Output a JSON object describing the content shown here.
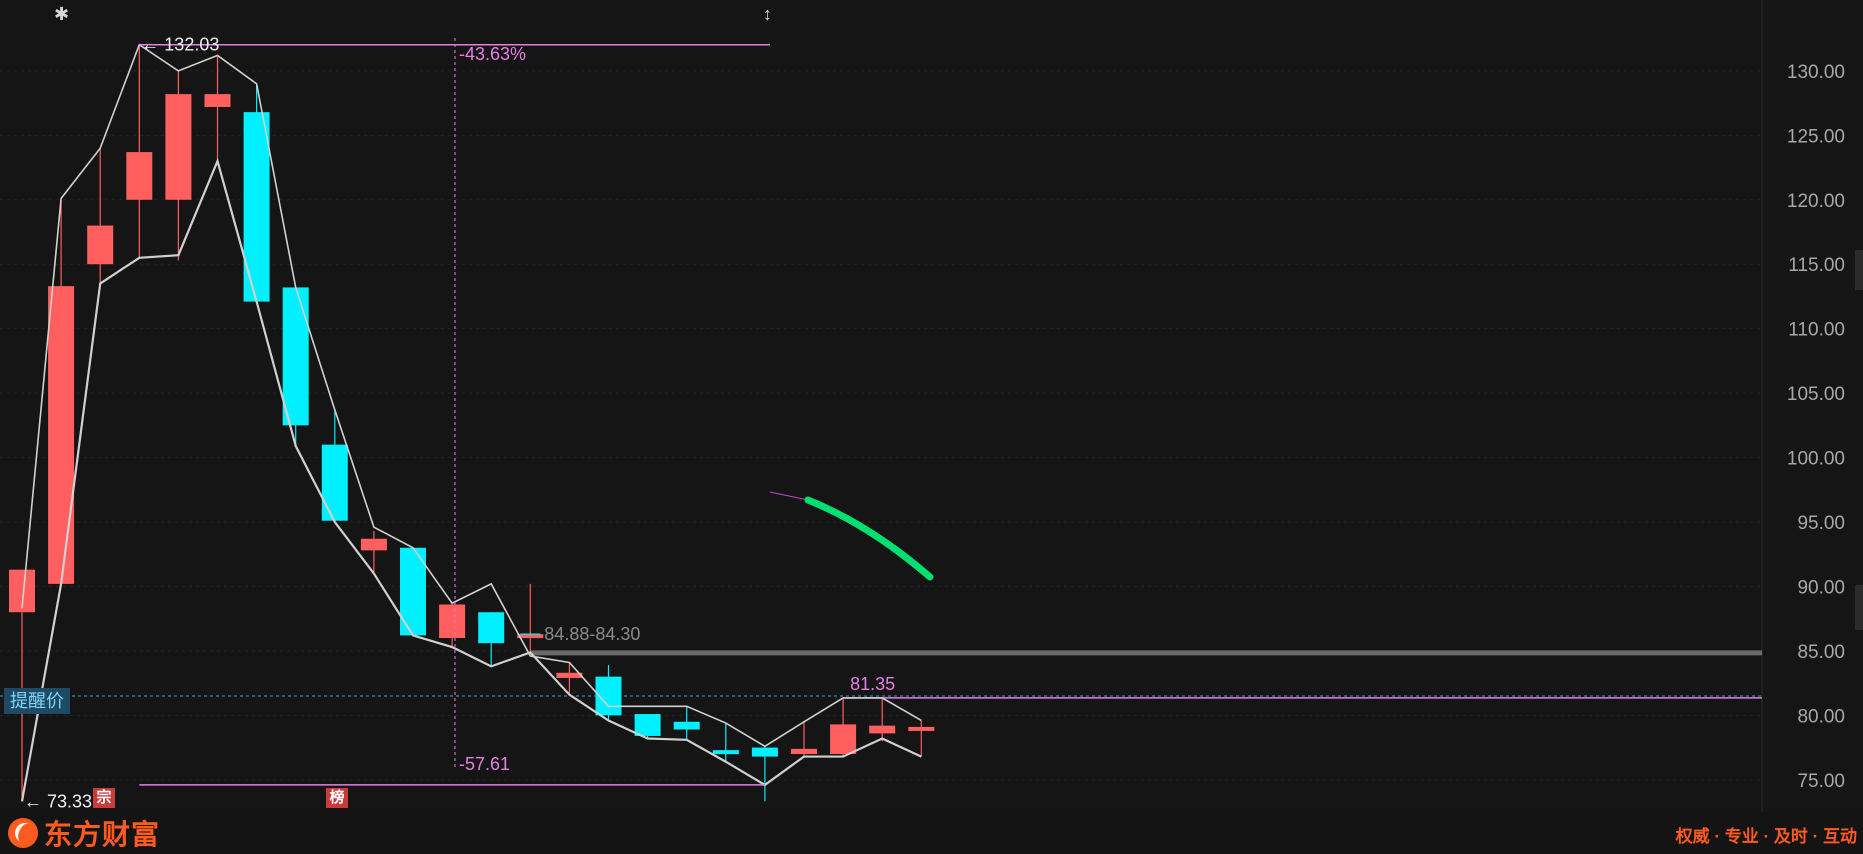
{
  "chart_data": {
    "type": "candlestick",
    "ylim": [
      72.5,
      135.5
    ],
    "y_ticks": [
      "75.00",
      "80.00",
      "85.00",
      "90.00",
      "95.00",
      "100.00",
      "105.00",
      "110.00",
      "115.00",
      "120.00",
      "125.00",
      "130.00"
    ],
    "candles": [
      {
        "open": 88.0,
        "close": 91.3,
        "high": 91.3,
        "low": 73.33
      },
      {
        "open": 90.2,
        "close": 113.3,
        "high": 120.0,
        "low": 90.2
      },
      {
        "open": 115.0,
        "close": 118.0,
        "high": 124.0,
        "low": 113.5
      },
      {
        "open": 120.0,
        "close": 123.7,
        "high": 132.03,
        "low": 115.5
      },
      {
        "open": 120.0,
        "close": 128.2,
        "high": 130.0,
        "low": 115.3
      },
      {
        "open": 127.2,
        "close": 128.2,
        "high": 131.2,
        "low": 123.0
      },
      {
        "open": 126.8,
        "close": 112.1,
        "high": 129.0,
        "low": 112.1
      },
      {
        "open": 113.2,
        "close": 102.5,
        "high": 113.2,
        "low": 100.9
      },
      {
        "open": 101.0,
        "close": 95.1,
        "high": 103.7,
        "low": 95.0
      },
      {
        "open": 92.8,
        "close": 93.7,
        "high": 94.3,
        "low": 91.0
      },
      {
        "open": 93.0,
        "close": 86.2,
        "high": 93.0,
        "low": 86.2
      },
      {
        "open": 86.0,
        "close": 88.6,
        "high": 88.7,
        "low": 85.2
      },
      {
        "open": 88.0,
        "close": 85.6,
        "high": 88.0,
        "low": 83.8
      },
      {
        "open": 86.3,
        "close": 86.3,
        "high": 90.2,
        "low": 84.88
      },
      {
        "open": 82.9,
        "close": 83.3,
        "high": 84.1,
        "low": 81.6
      },
      {
        "open": 83.0,
        "close": 80.0,
        "high": 83.9,
        "low": 79.6
      },
      {
        "open": 80.1,
        "close": 78.4,
        "high": 80.1,
        "low": 78.2
      },
      {
        "open": 79.5,
        "close": 78.9,
        "high": 80.7,
        "low": 78.1
      },
      {
        "open": 77.3,
        "close": 77.0,
        "high": 79.4,
        "low": 76.4
      },
      {
        "open": 77.5,
        "close": 76.8,
        "high": 77.6,
        "low": 73.33
      },
      {
        "open": 77.0,
        "close": 77.4,
        "high": 79.5,
        "low": 76.8
      },
      {
        "open": 77.0,
        "close": 79.3,
        "high": 81.35,
        "low": 76.8
      },
      {
        "open": 78.6,
        "close": 79.2,
        "high": 81.35,
        "low": 78.0
      },
      {
        "open": 78.9,
        "close": 79.1,
        "high": 79.6,
        "low": 76.8
      }
    ],
    "upper_line": [
      88.3,
      120.1,
      124.0,
      132.03,
      130.0,
      131.2,
      129.0,
      113.2,
      103.7,
      94.6,
      93.0,
      88.7,
      90.2,
      84.6,
      84.1,
      80.7,
      80.7,
      80.7,
      79.4,
      77.6,
      79.5,
      81.35,
      81.35,
      79.6
    ],
    "lower_line": [
      73.33,
      90.2,
      113.5,
      115.5,
      115.7,
      123.0,
      112.1,
      100.9,
      95.0,
      91.0,
      86.2,
      85.3,
      83.8,
      84.88,
      81.6,
      79.6,
      78.2,
      78.1,
      76.4,
      74.6,
      76.8,
      76.8,
      78.2,
      76.8
    ],
    "annotations": {
      "high_label": "132.03",
      "low_label": "73.33",
      "pct_up": "-43.63%",
      "pct_down": "-57.61",
      "range_label": "84.88-84.30",
      "level_label": "81.35",
      "alert_price": 81.5,
      "support_price": 84.85
    },
    "colors": {
      "up": "#ff5f5f",
      "down": "#00f0ff",
      "line": "#d0d0d0",
      "annotation": "#e67ee6",
      "level": "#6a6a6a",
      "alert": "#3fa7d6",
      "stroke": "#00e070"
    }
  },
  "overlay": {
    "alert_tag": "提醒价",
    "badge_1": "宗",
    "badge_2": "榜"
  },
  "footer": {
    "brand": "东方财富",
    "slogan": "权威 · 专业 · 及时 · 互动"
  },
  "icons": {
    "top_left": "gear-icon",
    "top_mid": "resize-vertical-icon"
  }
}
